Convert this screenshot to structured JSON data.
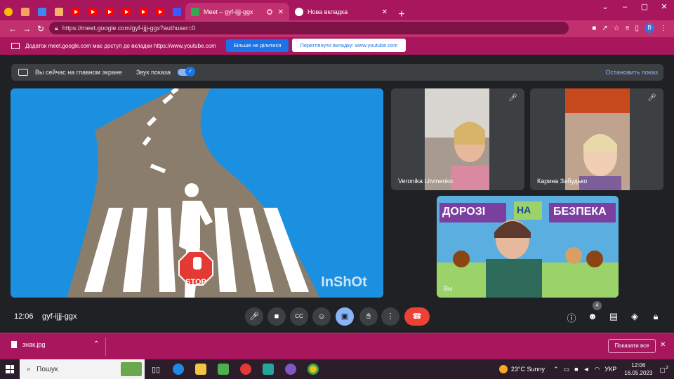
{
  "browser": {
    "tabs": [
      {
        "title": "Meet – gyf-ijjj-ggx",
        "active": true
      },
      {
        "title": "Нова вкладка",
        "active": false
      }
    ],
    "url": "https://meet.google.com/gyf-ijjj-ggx?authuser=0",
    "profile_initial": "B"
  },
  "infobar": {
    "message": "Додаток meet.google.com має доступ до вкладки https://www.youtube.com",
    "stop_sharing_label": "Більше не ділитися",
    "switch_tab_label": "Переглянути вкладку: www.youtube.com"
  },
  "present_bar": {
    "status": "Вы сейчас на главном экране",
    "audio_label": "Звук показа",
    "stop_label": "Остановить показ"
  },
  "main_tile": {
    "sign_text": "STOP",
    "watermark": "InShOt"
  },
  "participants": [
    {
      "name": "Veronika Litvinenko"
    },
    {
      "name": "Карина Забудько"
    },
    {
      "name": "Вы",
      "banner_words": [
        "ДОРОЗІ",
        "НА",
        "БЕЗПЕКА"
      ]
    }
  ],
  "bottom_bar": {
    "time": "12:06",
    "meeting_code": "gyf-ijjj-ggx",
    "participant_count": "4",
    "cc_label": "CC"
  },
  "downloads": {
    "file_name": "знак.jpg",
    "show_all_label": "Показати все"
  },
  "taskbar": {
    "search_label": "Пошук",
    "weather": "23°C  Sunny",
    "language": "УКР",
    "clock_time": "12:06",
    "clock_date": "16.05.2023",
    "notifications": "2"
  }
}
